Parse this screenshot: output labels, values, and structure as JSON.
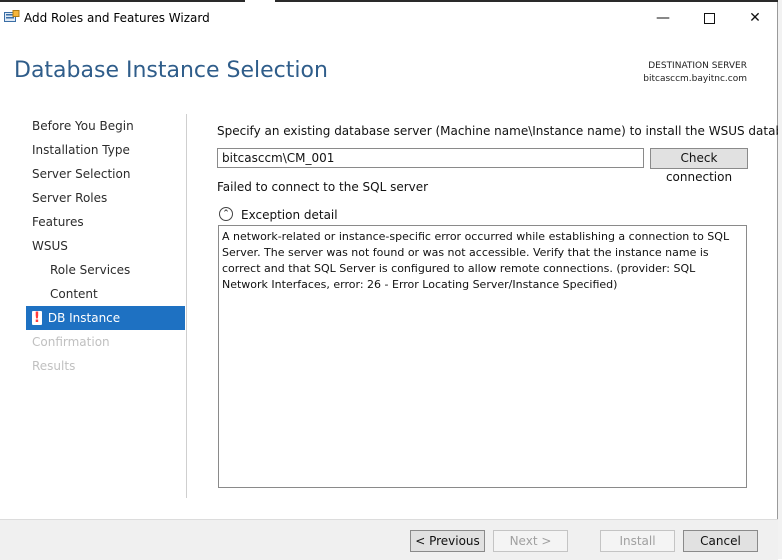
{
  "window": {
    "title": "Add Roles and Features Wizard",
    "minimize_glyph": "—",
    "close_glyph": "✕"
  },
  "header": {
    "page_title": "Database Instance Selection",
    "destination_label": "DESTINATION SERVER",
    "destination_server": "bitcasccm.bayitnc.com"
  },
  "nav": {
    "items": [
      {
        "label": "Before You Begin"
      },
      {
        "label": "Installation Type"
      },
      {
        "label": "Server Selection"
      },
      {
        "label": "Server Roles"
      },
      {
        "label": "Features"
      },
      {
        "label": "WSUS"
      },
      {
        "label": "Role Services"
      },
      {
        "label": "Content"
      },
      {
        "label": "DB Instance",
        "error_glyph": "!"
      },
      {
        "label": "Confirmation"
      },
      {
        "label": "Results"
      }
    ]
  },
  "main": {
    "instruction": "Specify an existing database server (Machine name\\Instance name) to install the WSUS database:",
    "server_value": "bitcasccm\\CM_001",
    "check_button": "Check connection",
    "status": "Failed to connect to the SQL server",
    "exception_toggle_glyph": "⌃",
    "exception_label": "Exception detail",
    "exception_text": "A network-related or instance-specific error occurred while establishing a connection to SQL Server. The server was not found or was not accessible. Verify that the instance name is correct and that SQL Server is configured to allow remote connections. (provider: SQL Network Interfaces, error: 26 - Error Locating Server/Instance Specified)"
  },
  "footer": {
    "previous": "< Previous",
    "next": "Next >",
    "install": "Install",
    "cancel": "Cancel"
  },
  "colors": {
    "title_blue": "#2f5d8a",
    "nav_selected": "#1e71c2",
    "error_red": "#ff3b3b"
  }
}
